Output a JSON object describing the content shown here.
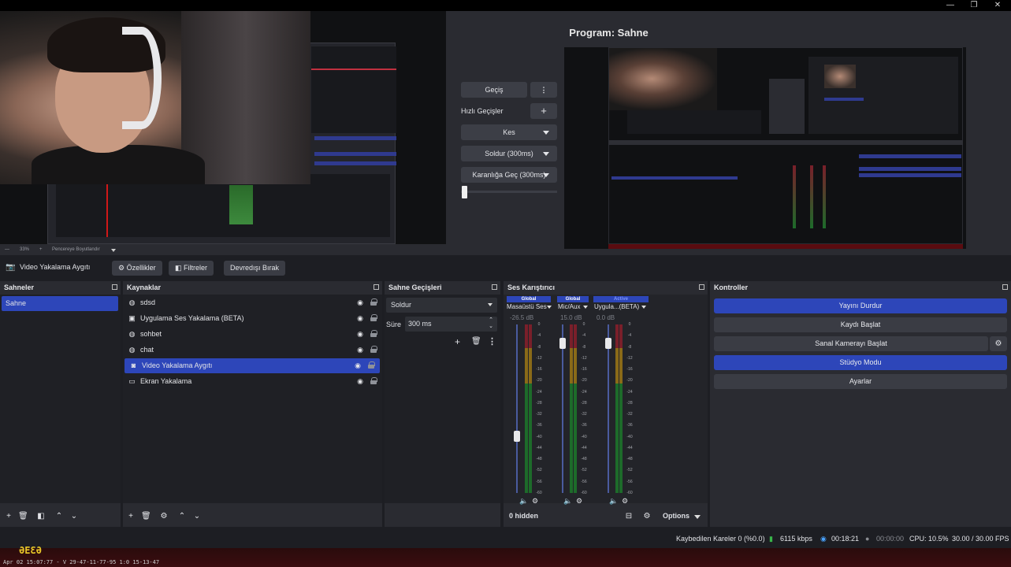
{
  "window": {
    "minimize_glyph": "—",
    "maximize_glyph": "❐",
    "close_glyph": "✕"
  },
  "program": {
    "title": "Program: Sahne"
  },
  "zoom_bar": {
    "zoom": "33%",
    "plus": "+",
    "resize_label": "Pencereye Boyutlandır"
  },
  "transitions_panel": {
    "transition_button": "Geçiş",
    "quick_transitions_label": "Hızlı Geçişler",
    "items": [
      "Kes",
      "Soldur (300ms)",
      "Karanlığa Geç (300ms)"
    ]
  },
  "source_toolbar": {
    "source_name": "Video Yakalama Aygıtı",
    "properties": "Özellikler",
    "filters": "Filtreler",
    "deactivate": "Devredışı Bırak"
  },
  "scenes": {
    "title": "Sahneler",
    "items": [
      {
        "label": "Sahne",
        "selected": true
      }
    ]
  },
  "sources": {
    "title": "Kaynaklar",
    "items": [
      {
        "label": "sdsd",
        "icon": "globe-icon"
      },
      {
        "label": "Uygulama Ses Yakalama (BETA)",
        "icon": "app-audio-icon"
      },
      {
        "label": "sohbet",
        "icon": "globe-icon"
      },
      {
        "label": "chat",
        "icon": "globe-icon"
      },
      {
        "label": "Video Yakalama Aygıtı",
        "icon": "camera-icon",
        "selected": true
      },
      {
        "label": "Ekran Yakalama",
        "icon": "monitor-icon"
      }
    ]
  },
  "scene_transitions": {
    "title": "Sahne Geçişleri",
    "selected": "Soldur",
    "duration_label": "Süre",
    "duration_value": "300 ms"
  },
  "audio_mixer": {
    "title": "Ses Karıştırıcı",
    "hidden_count": "0 hidden",
    "options": "Options",
    "channels": [
      {
        "head": "Global",
        "name": "Masaüstü Ses",
        "db": "-26.5 dB",
        "level": 0.41
      },
      {
        "head": "Global",
        "name": "Mic/Aux",
        "db": "15.0 dB",
        "level": 1.0
      },
      {
        "head": "Active",
        "name": "Uygula...(BETA)",
        "db": "0.0 dB",
        "level": 1.0
      }
    ],
    "scale": [
      "0",
      "-4",
      "-8",
      "-12",
      "-16",
      "-20",
      "-24",
      "-28",
      "-32",
      "-36",
      "-40",
      "-44",
      "-48",
      "-52",
      "-56",
      "-60"
    ]
  },
  "controls": {
    "title": "Kontroller",
    "stop_stream": "Yayını Durdur",
    "start_recording": "Kaydı Başlat",
    "start_virtual_cam": "Sanal Kamerayı Başlat",
    "studio_mode": "Stüdyo Modu",
    "settings": "Ayarlar"
  },
  "status": {
    "dropped_frames": "Kaybedilen Kareler 0 (%0.0)",
    "bitrate": "6115 kbps",
    "stream_time": "00:18:21",
    "record_time": "00:00:00",
    "cpu": "CPU: 10.5%",
    "fps": "30.00 / 30.00 FPS"
  },
  "overlay": {
    "timestamp": "Apr 02 15:07:77 - V 29-47-11-77-95 1:0 15-13-47",
    "logo_text": "ƏEƐƏ"
  },
  "colors": {
    "accent": "#2d46b9",
    "panel": "#2a2b31",
    "background": "#1d1e23"
  }
}
